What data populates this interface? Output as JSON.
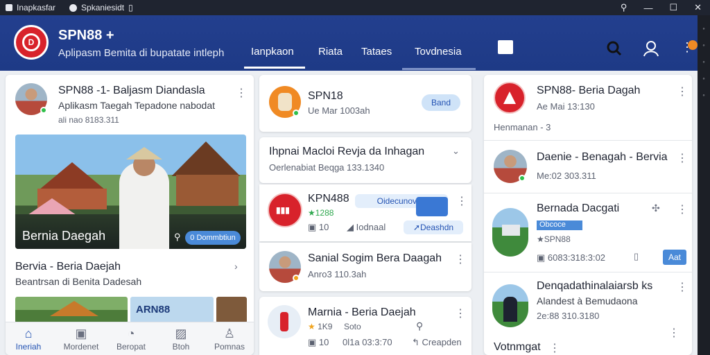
{
  "window": {
    "title": "Inapkasfar",
    "subtitle": "Spkaniesidt",
    "controls": [
      "⚲",
      "—",
      "☐",
      "✕"
    ]
  },
  "header": {
    "brand": "SPN88 +",
    "tagline": "Aplipasm Bemita di bupatate intleph",
    "nav": [
      "Ianpkaon",
      "Riata",
      "Tataes",
      "Tovdnesia"
    ],
    "icons": [
      "search-icon",
      "user-icon",
      "more-icon"
    ],
    "accent": "#1e3a86"
  },
  "left": {
    "post": {
      "title": "SPN88 -1- Baljasm Diandasla",
      "subtitle": "Aplikasm Taegah Tepadone nabodat",
      "meta": "ali nao 8183.311"
    },
    "hero": {
      "caption": "Bernia Daegah",
      "badge": "0 Dommbtiun"
    },
    "section": {
      "title": "Bervia - Beria Daejah",
      "subtitle": "Beantrsan di Benita Dadesah"
    },
    "thumb_text": "ARN88",
    "bottom_nav": [
      {
        "label": "Ineriah",
        "icon": "home-icon"
      },
      {
        "label": "Mordenet",
        "icon": "person-icon"
      },
      {
        "label": "Beropat",
        "icon": "chat-icon"
      },
      {
        "label": "Btoh",
        "icon": "image-icon"
      },
      {
        "label": "Pomnas",
        "icon": "profile-icon"
      }
    ]
  },
  "middle": {
    "card1": {
      "title": "SPN18",
      "meta": "Ue Mar 1003ah",
      "button": "Band"
    },
    "card2": {
      "title": "Ihpnai Macloi Revja da Inhagan",
      "meta": "Oerlenabiat  Beqga 133.1340"
    },
    "card3": {
      "title": "KPN488",
      "rating": "★1288",
      "tag": "Oidecunovao",
      "count": "10",
      "action1": "Iodnaal",
      "action2": "Deashdn"
    },
    "card4": {
      "title": "Sanial Sogim Bera Daagah",
      "meta": "Anro3 110.3ah"
    },
    "card5": {
      "title": "Marnia - Beria Daejah",
      "rating": "1K9",
      "extra": "Soto",
      "count": "10",
      "date": "0l1a 03:3:70",
      "action": "Creapden"
    }
  },
  "right": {
    "item1": {
      "title": "SPN88- Beria Dagah",
      "meta": "Ae Mai 13:130",
      "note": "Henmanan - 3"
    },
    "item2": {
      "title": "Daenie - Benagah - Bervia",
      "meta": "Me:02 303.311"
    },
    "item3": {
      "title": "Bernada Dacgati",
      "tag": "Obcoce",
      "rating": "★SPN88",
      "meta": "6083:318:3:02",
      "button": "Aat"
    },
    "item4": {
      "title": "Denqadathinalaiarsb ks",
      "subtitle": "Alandest à Bemudaona",
      "meta": "2e:88 310.3180"
    },
    "footer": "Votnmgat"
  }
}
